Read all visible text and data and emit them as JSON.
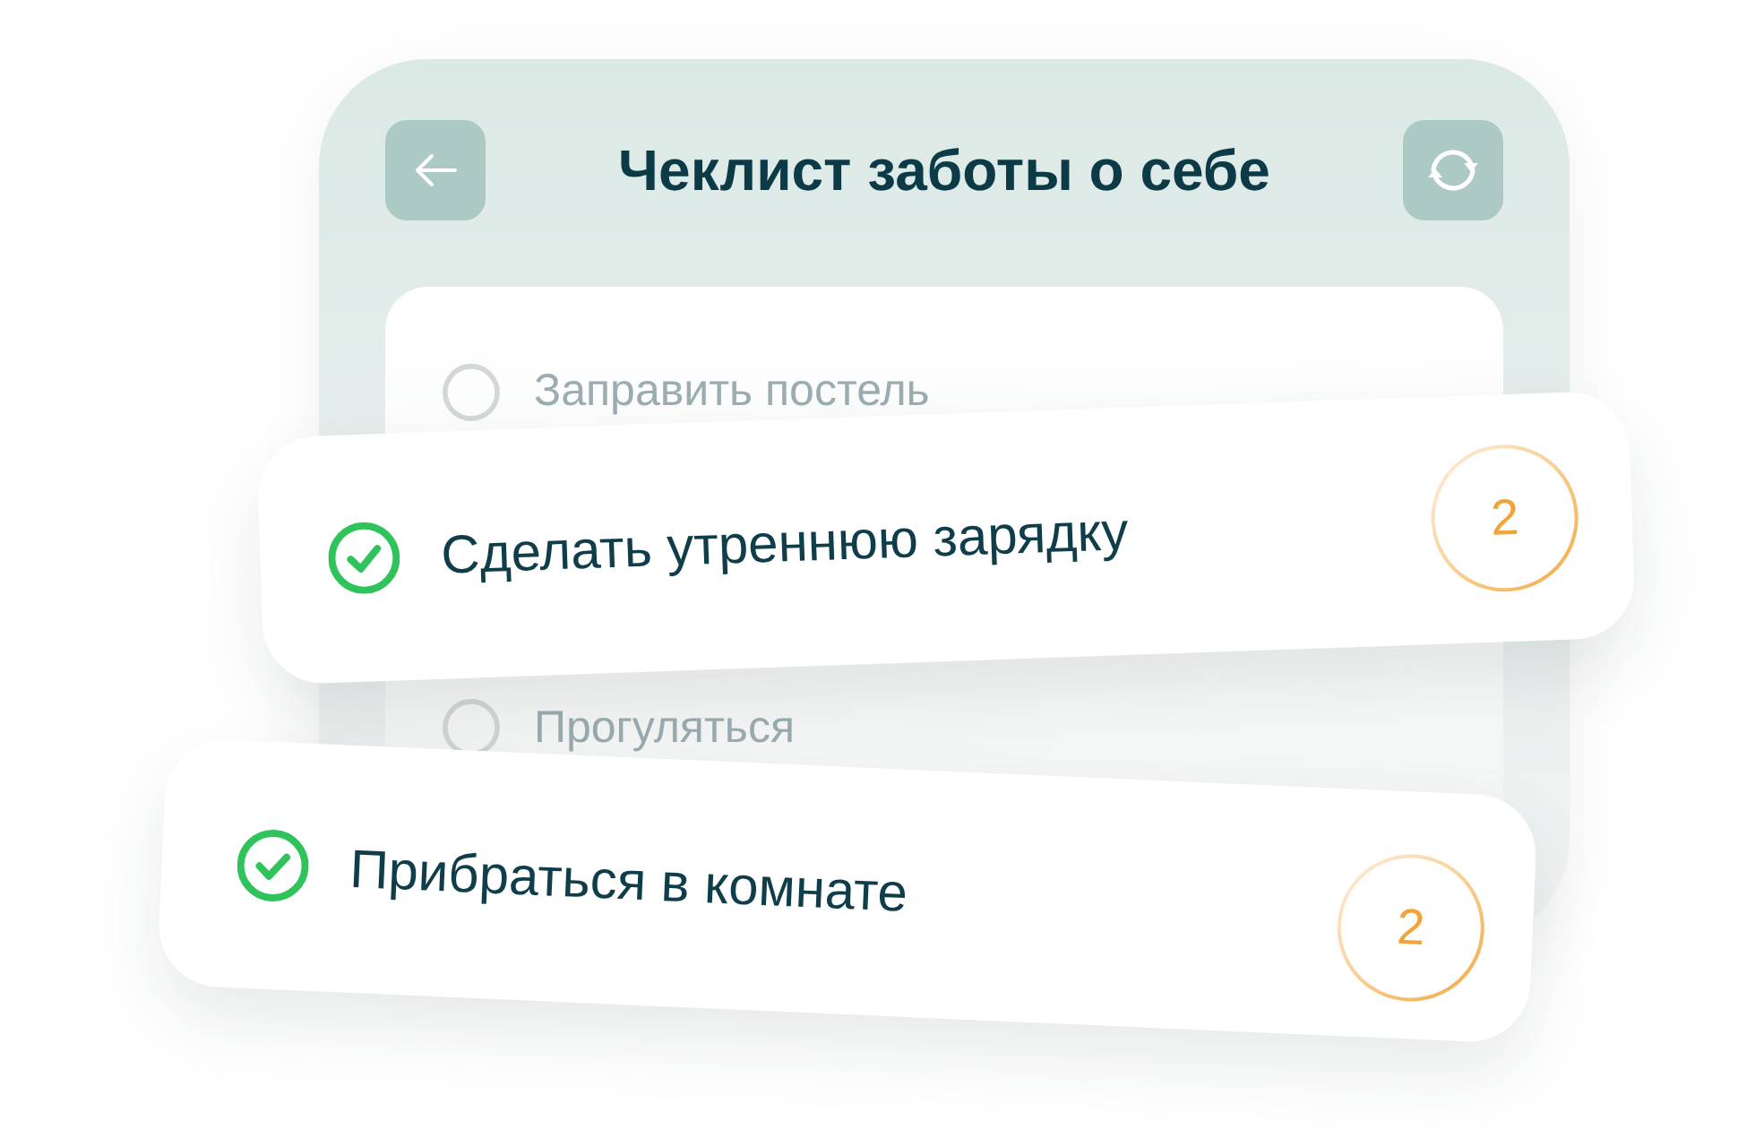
{
  "header": {
    "title": "Чеклист заботы о себе"
  },
  "checklist": [
    {
      "label": "Заправить постель",
      "checked": false
    },
    {
      "label": "Прогуляться",
      "checked": false
    }
  ],
  "highlighted_tasks": [
    {
      "label": "Сделать утреннюю зарядку",
      "checked": true,
      "count": "2"
    },
    {
      "label": "Прибраться в комнате",
      "checked": true,
      "count": "2"
    }
  ]
}
